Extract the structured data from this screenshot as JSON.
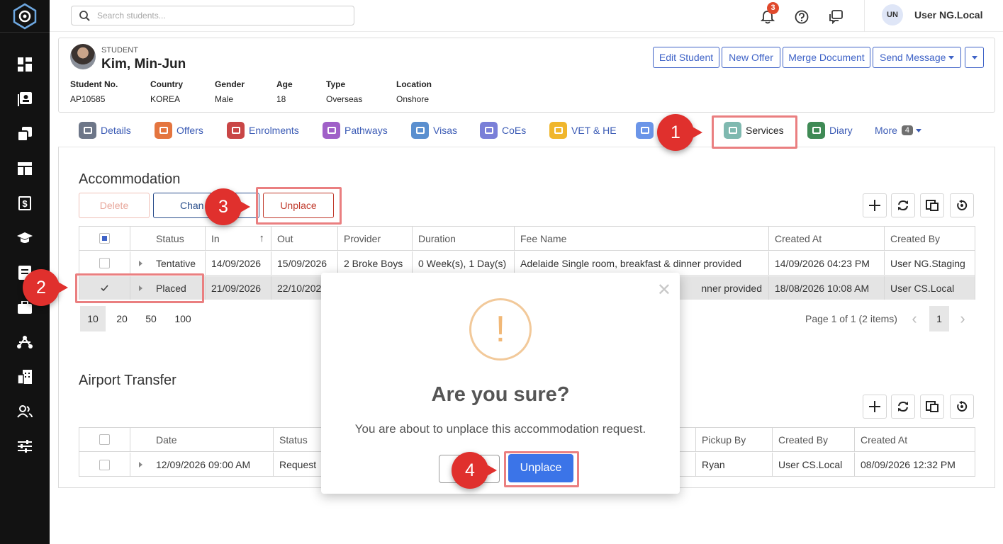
{
  "topbar": {
    "search_placeholder": "Search students...",
    "notification_count": "3",
    "user_initials": "UN",
    "user_name": "User NG.Local"
  },
  "student": {
    "label": "STUDENT",
    "name": "Kim, Min-Jun",
    "fields": [
      {
        "label": "Student No.",
        "value": "AP10585"
      },
      {
        "label": "Country",
        "value": "KOREA"
      },
      {
        "label": "Gender",
        "value": "Male"
      },
      {
        "label": "Age",
        "value": "18"
      },
      {
        "label": "Type",
        "value": "Overseas"
      },
      {
        "label": "Location",
        "value": "Onshore"
      }
    ],
    "buttons": {
      "edit": "Edit Student",
      "new_offer": "New Offer",
      "merge": "Merge Document",
      "send": "Send Message"
    }
  },
  "tabs": [
    {
      "label": "Details",
      "color": "#6d7688"
    },
    {
      "label": "Offers",
      "color": "#e4753f"
    },
    {
      "label": "Enrolments",
      "color": "#c94646"
    },
    {
      "label": "Pathways",
      "color": "#a060c8"
    },
    {
      "label": "Visas",
      "color": "#5a8fcf"
    },
    {
      "label": "CoEs",
      "color": "#7a7fd8"
    },
    {
      "label": "VET & HE",
      "color": "#f0b62c"
    },
    {
      "label": "",
      "color": "#6b95e8"
    },
    {
      "label": "Services",
      "color": "#7fb9b0"
    },
    {
      "label": "Diary",
      "color": "#3f8a55"
    }
  ],
  "more_tab": {
    "label": "More",
    "count": "4"
  },
  "accommodation": {
    "title": "Accommodation",
    "buttons": {
      "delete": "Delete",
      "change": "Chan",
      "unplace": "Unplace"
    },
    "columns": [
      "Status",
      "In",
      "Out",
      "Provider",
      "Duration",
      "Fee Name",
      "Created At",
      "Created By"
    ],
    "rows": [
      {
        "status": "Tentative",
        "in": "14/09/2026",
        "out": "15/09/2026",
        "provider": "2 Broke Boys",
        "duration": "0 Week(s), 1 Day(s)",
        "fee": "Adelaide Single room, breakfast & dinner provided",
        "created_at": "14/09/2026 04:23 PM",
        "created_by": "User NG.Staging"
      },
      {
        "status": "Placed",
        "in": "21/09/2026",
        "out": "22/10/202",
        "provider": "",
        "duration": "",
        "fee": "nner provided",
        "created_at": "18/08/2026 10:08 AM",
        "created_by": "User CS.Local"
      }
    ],
    "page_sizes": [
      "10",
      "20",
      "50",
      "100"
    ],
    "page_info": "Page 1 of 1 (2 items)",
    "current_page": "1"
  },
  "airport": {
    "title": "Airport Transfer",
    "columns_left": [
      "Date",
      "Status"
    ],
    "columns_right": [
      "Pickup By",
      "Created By",
      "Created At"
    ],
    "row": {
      "date": "12/09/2026 09:00 AM",
      "status": "Request",
      "pickup_by": "Ryan",
      "created_by": "User CS.Local",
      "created_at": "08/09/2026 12:32 PM"
    }
  },
  "dialog": {
    "icon": "!",
    "title": "Are you sure?",
    "text": "You are about to unplace this accommodation request.",
    "confirm": "Unplace"
  },
  "callouts": [
    "1",
    "2",
    "3",
    "4"
  ],
  "colors": {
    "accent": "#3f63c7",
    "callout": "#e0302d",
    "highlight": "#ea7f80",
    "confirm": "#3b74e8"
  }
}
